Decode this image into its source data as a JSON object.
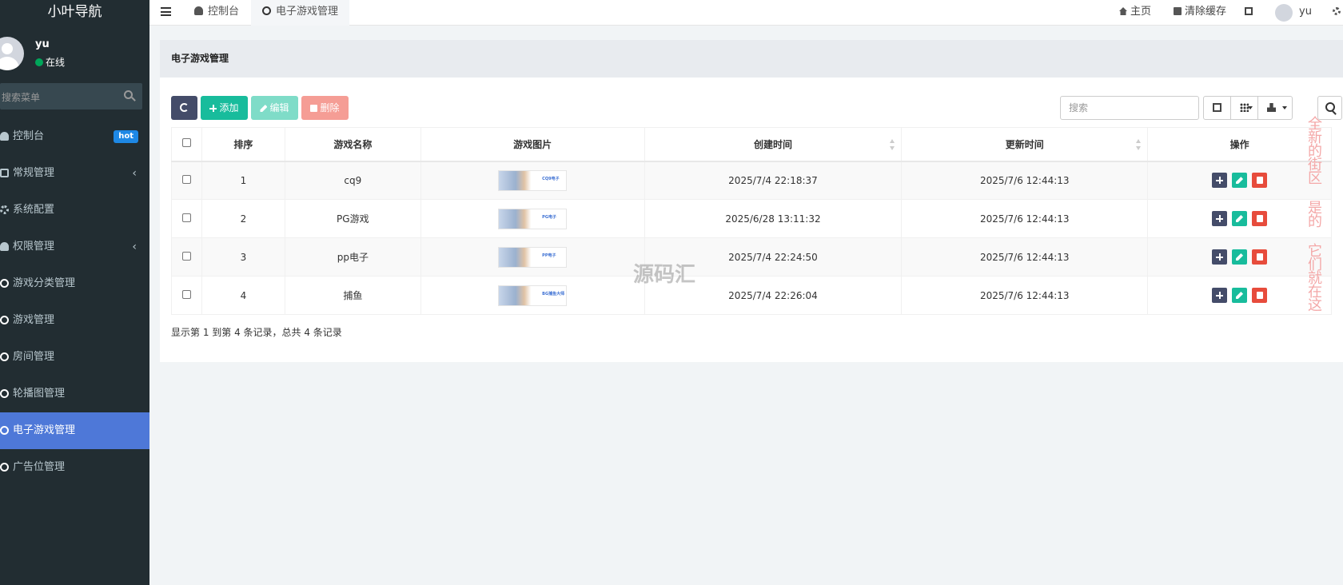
{
  "sidebar": {
    "brand": "小叶导航",
    "user": {
      "name": "yu",
      "status": "在线"
    },
    "search_placeholder": "搜索菜单",
    "items": [
      {
        "label": "控制台",
        "badge": "hot"
      },
      {
        "label": "常规管理",
        "caret": "‹"
      },
      {
        "label": "系统配置"
      },
      {
        "label": "权限管理",
        "caret": "‹"
      },
      {
        "label": "游戏分类管理"
      },
      {
        "label": "游戏管理"
      },
      {
        "label": "房间管理"
      },
      {
        "label": "轮播图管理"
      },
      {
        "label": "电子游戏管理",
        "active": true
      },
      {
        "label": "广告位管理"
      }
    ]
  },
  "header": {
    "tabs": [
      {
        "label": "控制台",
        "icon": "dashboard-icon"
      },
      {
        "label": "电子游戏管理",
        "icon": "circle-icon",
        "active": true
      }
    ],
    "links": {
      "home": "主页",
      "clear_cache": "清除缓存",
      "user": "yu"
    }
  },
  "panel": {
    "title": "电子游戏管理"
  },
  "toolbar": {
    "add": "添加",
    "edit": "编辑",
    "delete": "删除",
    "search_placeholder": "搜索"
  },
  "table": {
    "columns": [
      "排序",
      "游戏名称",
      "游戏图片",
      "创建时间",
      "更新时间",
      "操作"
    ],
    "rows": [
      {
        "order": "1",
        "name": "cq9",
        "image_label": "CQ9电子",
        "created": "2025/7/4 22:18:37",
        "updated": "2025/7/6 12:44:13"
      },
      {
        "order": "2",
        "name": "PG游戏",
        "image_label": "PG电子",
        "created": "2025/6/28 13:11:32",
        "updated": "2025/7/6 12:44:13"
      },
      {
        "order": "3",
        "name": "pp电子",
        "image_label": "PP电子",
        "created": "2025/7/4 22:24:50",
        "updated": "2025/7/6 12:44:13"
      },
      {
        "order": "4",
        "name": "捕鱼",
        "image_label": "BG捕鱼大师",
        "created": "2025/7/4 22:26:04",
        "updated": "2025/7/6 12:44:13"
      }
    ]
  },
  "pagination_info": "显示第 1 到第 4 条记录，总共 4 条记录",
  "watermark": "源码汇",
  "vertical_ad": "全新的街区 是的 它们就在这",
  "colors": {
    "sidebar_bg": "#222d32",
    "active_menu": "#4e78d8",
    "btn_add": "#18bc9c",
    "btn_refresh": "#444c69",
    "btn_delete": "#f59d95",
    "op_delete": "#e74c3c"
  }
}
